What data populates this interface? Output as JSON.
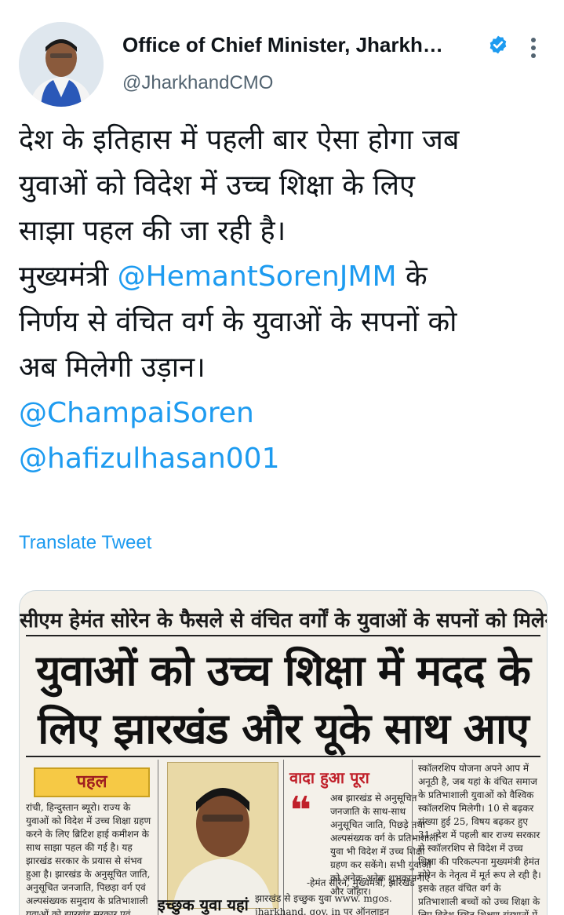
{
  "tweet": {
    "author_name": "Office of Chief Minister, Jharkh…",
    "handle": "@JharkhandCMO",
    "lines": [
      "देश के इतिहास में पहली बार ऐसा होगा जब",
      "युवाओं को विदेश में उच्च शिक्षा के लिए",
      "साझा पहल की जा रही है।"
    ],
    "line4_prefix": "मुख्यमंत्री ",
    "line4_mention": "@HemantSorenJMM",
    "line4_suffix": " के",
    "line5": "निर्णय से वंचित वर्ग के युवाओं के सपनों को",
    "line6": "अब मिलेगी उड़ान।",
    "mention2": "@ChampaiSoren",
    "mention3": "@hafizulhasan001",
    "translate_label": "Translate Tweet"
  },
  "newspaper": {
    "kicker": "सीएम हेमंत सोरेन के फैसले से वंचित वर्गों के युवाओं के सपनों को मिलेगी उड़ान",
    "headline_1": "युवाओं को उच्च शिक्षा में मदद के",
    "headline_2": "लिए झारखंड और यूके साथ आए",
    "pahal_label": "पहल",
    "col1": "रांची, हिन्दुस्तान ब्यूरो। राज्य के युवाओं को विदेश में उच्च शिक्षा ग्रहण करने के लिए ब्रिटिश हाई कमीशन के साथ साझा पहल की गई है। यह झारखंड सरकार के प्रयास से संभव हुआ है। झारखंड के अनुसूचित जाति, अनुसूचित जनजाति, पिछड़ा वर्ग एवं अल्पसंख्यक समुदाय के प्रतिभाशाली युवाओं को झारखंड सरकार एवं",
    "wada_label": "वादा हुआ पूरा",
    "quote_text": "अब झारखंड से अनुसूचित जनजाति के साथ-साथ अनुसूचित जाति, पिछड़े तथा अल्पसंख्यक वर्ग के प्रतिभाशाली युवा भी विदेश में उच्च शिक्षा ग्रहण कर सकेंगे। सभी युवाओं को अनेक-अनेक शुभकामनाएं और जोहार।",
    "quote_author": "-हेमंत सोरेन, मुख्यमंत्री, झारखंड",
    "icchuk_label": "इच्छुक युवा यहां",
    "icchuk_text": "झारखंड से इच्छुक युवा www. mgos. jharkhand. gov. in पर ऑनलाइन",
    "col3": "स्कॉलरशिप योजना अपने आप में अनूठी है, जब यहां के वंचित समाज के प्रतिभाशाली युवाओं को वैश्विक स्कॉलरशिप मिलेगी। 10 से बढ़कर संख्या हुई 25, विषय बढ़कर हुए 31: देश में पहली बार राज्य सरकार से स्कॉलरशिप से विदेश में उच्च शिक्षा की परिकल्पना मुख्यमंत्री हेमंत सोरेन के नेतृत्व में मूर्त रूप ले रही है। इसके तहत वंचित वर्ग के प्रतिभाशाली बच्चों को उच्च शिक्षा के लिए विदेश स्थित शिक्षण संस्थानों में भेजने की"
  },
  "colors": {
    "link": "#1d9bf0",
    "verified": "#1d9bf0",
    "secondary_text": "#536471",
    "news_red": "#c0202a",
    "pahal_yellow": "#f6c945"
  },
  "icons": {
    "verified": "verified-badge-icon",
    "more": "more-vertical-icon"
  }
}
